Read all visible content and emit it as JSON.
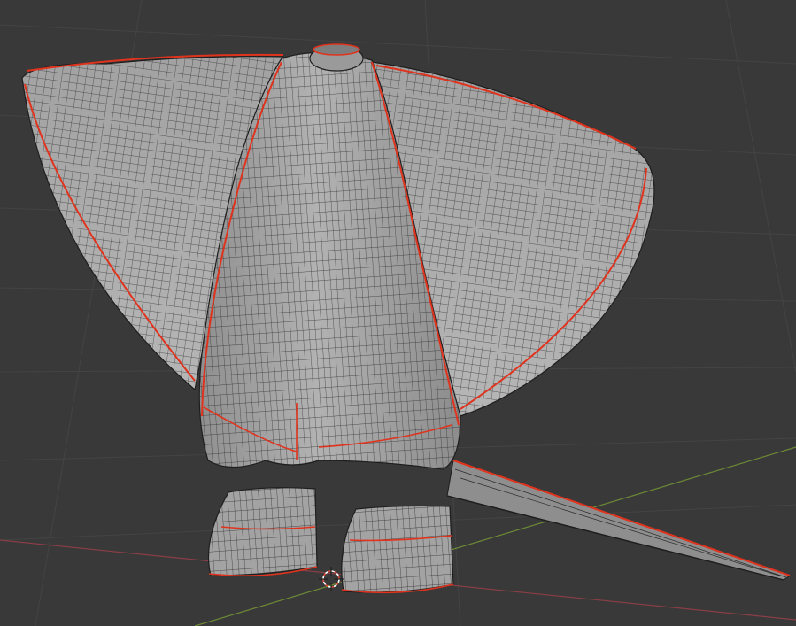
{
  "app": {
    "kind": "3D modeling viewport",
    "view": "perspective",
    "overlays": {
      "floor_grid": true,
      "x_axis_line": true,
      "y_axis_line": true,
      "wireframe_overlay": true,
      "seam_edges_highlight": true,
      "cursor_3d": true
    }
  },
  "colors": {
    "background": "#393939",
    "grid": "#4a4a4a",
    "x_axis": "#8a3e46",
    "y_axis": "#6d8a35",
    "mesh_fill": "#a9a9a9",
    "mesh_shadow": "#8e8e8e",
    "wire": "#2a2a2a",
    "seam": "#e0331d",
    "cursor": "#ffffff",
    "cursor_ring": "#e14b3a"
  },
  "icons": {
    "cursor": "3d-cursor-icon"
  }
}
